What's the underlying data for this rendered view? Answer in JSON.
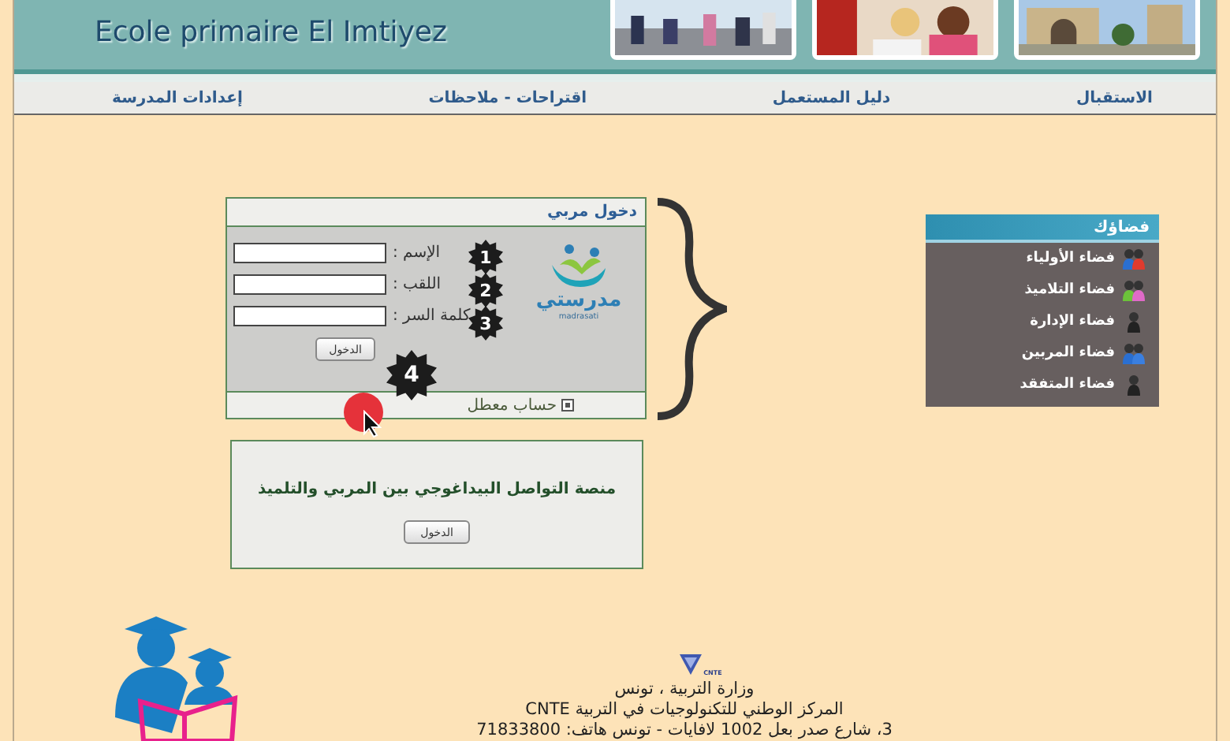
{
  "header": {
    "school_name": "Ecole primaire El Imtiyez"
  },
  "nav": [
    {
      "label": "الاستقبال"
    },
    {
      "label": "دليل المستعمل"
    },
    {
      "label": "اقتراحات - ملاحظات"
    },
    {
      "label": "إعدادات المدرسة"
    }
  ],
  "login": {
    "title": "دخول مربي",
    "logo": {
      "name": "مدرستي",
      "subtitle": "madrasati"
    },
    "fields": [
      {
        "label": "الإسم :",
        "badge": "1"
      },
      {
        "label": "اللقب :",
        "badge": "2"
      },
      {
        "label": "كلمة السر :",
        "badge": "3"
      }
    ],
    "submit": {
      "label": "الدخول",
      "badge": "4"
    },
    "footer_link": "حساب معطل"
  },
  "platform": {
    "text": "منصة التواصل البيداغوجي بين المربي والتلميذ",
    "button": "الدخول"
  },
  "spaces": {
    "title": "فضاؤك",
    "items": [
      {
        "label": "فضاء الأولياء",
        "kind": "parents"
      },
      {
        "label": "فضاء التلاميذ",
        "kind": "pupils"
      },
      {
        "label": "فضاء الإدارة",
        "kind": "single"
      },
      {
        "label": "فضاء المربين",
        "kind": "teachers"
      },
      {
        "label": "فضاء المتفقد",
        "kind": "single"
      }
    ]
  },
  "footer": {
    "cnte_logo": "CNTE",
    "lines": [
      "وزارة التربية ، تونس",
      "المركز الوطني للتكنولوجيات في التربية CNTE",
      "3، شارع صدر بعل 1002 لافايات - تونس هاتف: 71833800"
    ]
  }
}
